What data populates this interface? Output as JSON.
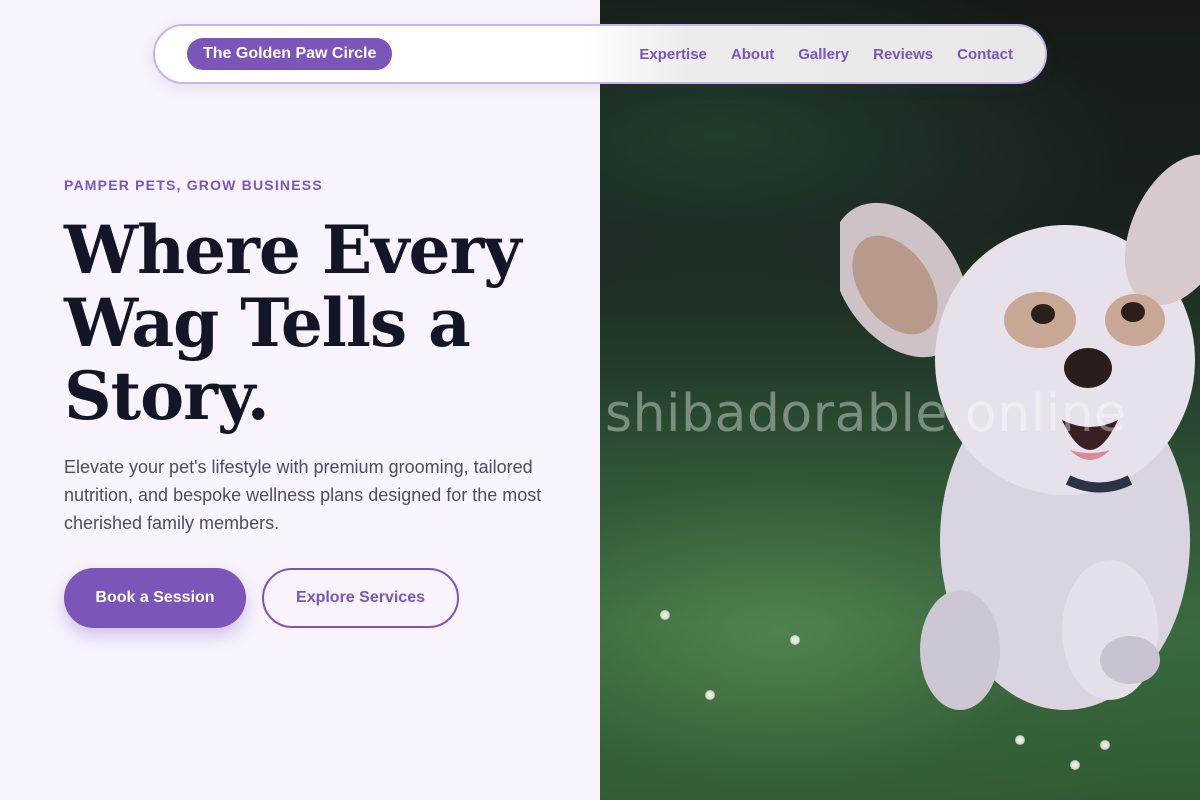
{
  "nav": {
    "brand": "The Golden Paw Circle",
    "links": [
      "Expertise",
      "About",
      "Gallery",
      "Reviews",
      "Contact"
    ]
  },
  "hero": {
    "eyebrow": "PAMPER PETS, GROW BUSINESS",
    "headline_lines": [
      "Where Every",
      "Wag Tells a",
      "Story."
    ],
    "subtext": "Elevate your pet's lifestyle with premium grooming, tailored nutrition, and bespoke wellness plans designed for the most cherished family members.",
    "primary_cta": "Book a Session",
    "secondary_cta": "Explore Services"
  },
  "photo": {
    "watermark": "shibadorable.online"
  },
  "colors": {
    "accent": "#7c55b8",
    "background": "#f8f3fd",
    "headline": "#121626",
    "body_text": "#4a4f5c"
  }
}
